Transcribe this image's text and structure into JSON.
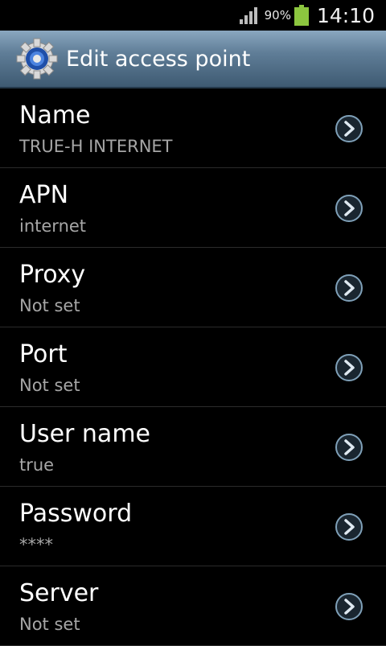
{
  "status_bar": {
    "battery_percent": "90%",
    "time": "14:10",
    "icons": [
      "signal-icon",
      "battery-icon"
    ]
  },
  "header": {
    "title": "Edit access point",
    "icon": "gear-icon"
  },
  "items": [
    {
      "label": "Name",
      "value": "TRUE-H INTERNET"
    },
    {
      "label": "APN",
      "value": "internet"
    },
    {
      "label": "Proxy",
      "value": "Not set"
    },
    {
      "label": "Port",
      "value": "Not set"
    },
    {
      "label": "User name",
      "value": "true"
    },
    {
      "label": "Password",
      "value": "****"
    },
    {
      "label": "Server",
      "value": "Not set"
    }
  ],
  "colors": {
    "accent_green": "#8cc63f",
    "title_bar": "#5f7d97",
    "secondary_text": "#a6a6a6"
  }
}
